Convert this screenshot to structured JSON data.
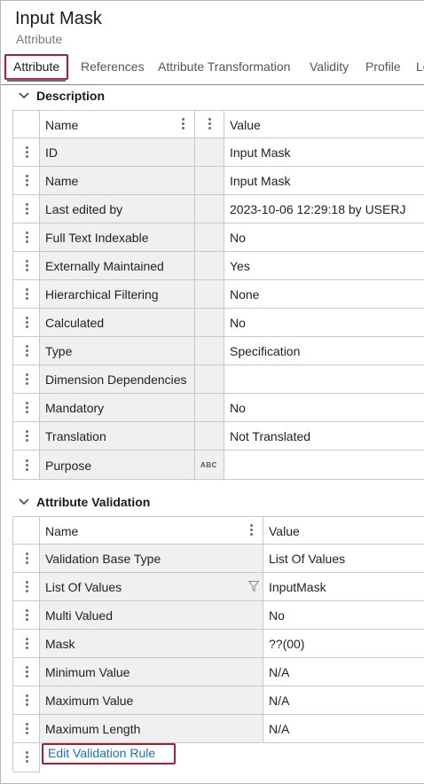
{
  "header": {
    "title": "Input Mask",
    "subtitle": "Attribute"
  },
  "tabs": [
    {
      "label": "Attribute",
      "active": true
    },
    {
      "label": "References"
    },
    {
      "label": "Attribute Transformation"
    },
    {
      "label": "Validity"
    },
    {
      "label": "Profile"
    },
    {
      "label": "Lo"
    }
  ],
  "description": {
    "heading": "Description",
    "columns": {
      "name": "Name",
      "value": "Value"
    },
    "rows": [
      {
        "name": "ID",
        "value": "Input Mask"
      },
      {
        "name": "Name",
        "value": "Input Mask"
      },
      {
        "name": "Last edited by",
        "value": "2023-10-06 12:29:18 by USERJ"
      },
      {
        "name": "Full Text Indexable",
        "value": "No"
      },
      {
        "name": "Externally Maintained",
        "value": "Yes"
      },
      {
        "name": "Hierarchical Filtering",
        "value": "None"
      },
      {
        "name": "Calculated",
        "value": "No"
      },
      {
        "name": "Type",
        "value": "Specification"
      },
      {
        "name": "Dimension Dependencies",
        "value": ""
      },
      {
        "name": "Mandatory",
        "value": "No"
      },
      {
        "name": "Translation",
        "value": "Not Translated"
      },
      {
        "name": "Purpose",
        "value": "",
        "type_badge": "ABC"
      }
    ]
  },
  "validation": {
    "heading": "Attribute Validation",
    "columns": {
      "name": "Name",
      "value": "Value"
    },
    "rows": [
      {
        "name": "Validation Base Type",
        "value": "List Of Values"
      },
      {
        "name": "List Of Values",
        "value": "InputMask",
        "has_filter": true
      },
      {
        "name": "Multi Valued",
        "value": "No"
      },
      {
        "name": "Mask",
        "value": "??(00)"
      },
      {
        "name": "Minimum Value",
        "value": "N/A"
      },
      {
        "name": "Maximum Value",
        "value": "N/A"
      },
      {
        "name": "Maximum Length",
        "value": "N/A"
      }
    ],
    "edit_link": "Edit Validation Rule"
  },
  "colors": {
    "highlight": "#9b2335",
    "link": "#1a73a8",
    "grid_line": "#c8c8c8",
    "name_cell_bg": "#f0f0f0"
  }
}
